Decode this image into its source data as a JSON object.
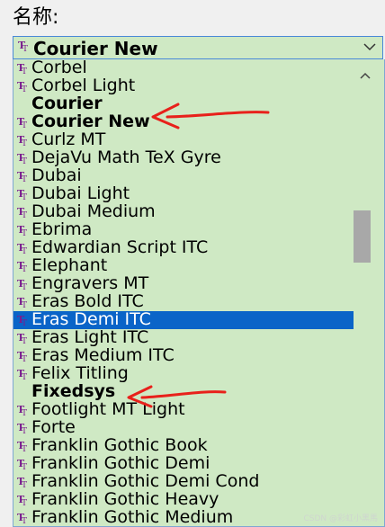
{
  "field_label": "名称:",
  "combo": {
    "value": "Courier New"
  },
  "fonts": [
    {
      "name": "Corbel",
      "bold": false,
      "icon": true
    },
    {
      "name": "Corbel Light",
      "bold": false,
      "icon": true
    },
    {
      "name": "Courier",
      "bold": true,
      "icon": false
    },
    {
      "name": "Courier New",
      "bold": true,
      "icon": true
    },
    {
      "name": "Curlz MT",
      "bold": false,
      "icon": true
    },
    {
      "name": "DejaVu Math TeX Gyre",
      "bold": false,
      "icon": true
    },
    {
      "name": "Dubai",
      "bold": false,
      "icon": true
    },
    {
      "name": "Dubai Light",
      "bold": false,
      "icon": true
    },
    {
      "name": "Dubai Medium",
      "bold": false,
      "icon": true
    },
    {
      "name": "Ebrima",
      "bold": false,
      "icon": true
    },
    {
      "name": "Edwardian Script ITC",
      "bold": false,
      "icon": true
    },
    {
      "name": "Elephant",
      "bold": false,
      "icon": true
    },
    {
      "name": "Engravers MT",
      "bold": false,
      "icon": true
    },
    {
      "name": "Eras Bold ITC",
      "bold": false,
      "icon": true
    },
    {
      "name": "Eras Demi ITC",
      "bold": false,
      "icon": true,
      "selected": true
    },
    {
      "name": "Eras Light ITC",
      "bold": false,
      "icon": true
    },
    {
      "name": "Eras Medium ITC",
      "bold": false,
      "icon": true
    },
    {
      "name": "Felix Titling",
      "bold": false,
      "icon": true
    },
    {
      "name": "Fixedsys",
      "bold": true,
      "icon": false
    },
    {
      "name": "Footlight MT Light",
      "bold": false,
      "icon": true
    },
    {
      "name": "Forte",
      "bold": false,
      "icon": true
    },
    {
      "name": "Franklin Gothic Book",
      "bold": false,
      "icon": true
    },
    {
      "name": "Franklin Gothic Demi",
      "bold": false,
      "icon": true
    },
    {
      "name": "Franklin Gothic Demi Cond",
      "bold": false,
      "icon": true
    },
    {
      "name": "Franklin Gothic Heavy",
      "bold": false,
      "icon": true
    },
    {
      "name": "Franklin Gothic Medium",
      "bold": false,
      "icon": true
    }
  ],
  "watermark": "CSDN @彩虹小黑馬",
  "colors": {
    "list_background": "#cfe9c4",
    "selection": "#0a64c8",
    "annotation_arrow": "#e8211b",
    "truetype_icon": "#7a1e8e"
  }
}
